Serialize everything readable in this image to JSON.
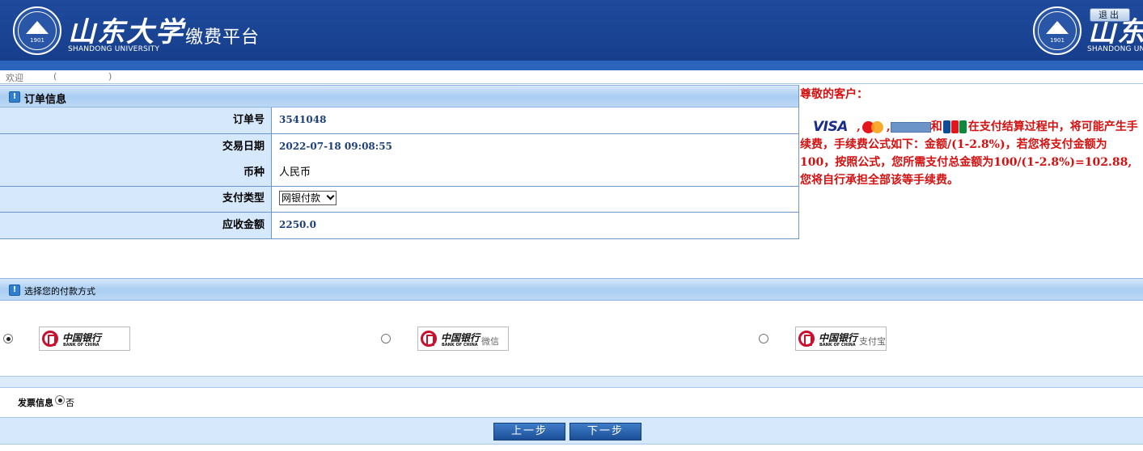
{
  "header": {
    "university_cn": "山东大学",
    "university_en": "SHANDONG UNIVERSITY",
    "seal_year": "1901",
    "platform_title": "缴费平台",
    "logout_label": "退出"
  },
  "welcome": {
    "label": "欢迎",
    "paren_open": "(",
    "paren_close": ")"
  },
  "order": {
    "section_title": "订单信息",
    "rows": [
      {
        "label": "订单号",
        "value": "3541048"
      },
      {
        "label": "交易日期",
        "value": "2022-07-18 09:08:55"
      },
      {
        "label": "币种",
        "value": "人民币"
      },
      {
        "label": "支付类型",
        "value": "网银付款"
      },
      {
        "label": "应收金额",
        "value": "2250.0"
      }
    ]
  },
  "notice": {
    "title": "尊敬的客户：",
    "card_visa": "VISA",
    "sep1": ",",
    "sep2": ",",
    "conj": "和",
    "text": "在支付结算过程中，将可能产生手续费，手续费公式如下：金额/(1-2.8%)，若您将支付金额为100，按照公式，您所需支付总金额为100/(1-2.8%)=102.88,您将自行承担全部该等手续费。"
  },
  "payment": {
    "section_title": "选择您的付款方式",
    "options": [
      {
        "bank_cn": "中国银行",
        "bank_en": "BANK OF CHINA",
        "suffix": "",
        "checked": true
      },
      {
        "bank_cn": "中国银行",
        "bank_en": "BANK OF CHINA",
        "suffix": "微信",
        "checked": false
      },
      {
        "bank_cn": "中国银行",
        "bank_en": "BANK OF CHINA",
        "suffix": "支付宝",
        "checked": false
      }
    ]
  },
  "invoice": {
    "label": "发票信息",
    "no_label": "否"
  },
  "buttons": {
    "prev": "上一步",
    "next": "下一步"
  },
  "colors": {
    "header_blue": "#1f4a9c",
    "notice_red": "#d41010",
    "label_bg": "#d6e8fb"
  }
}
